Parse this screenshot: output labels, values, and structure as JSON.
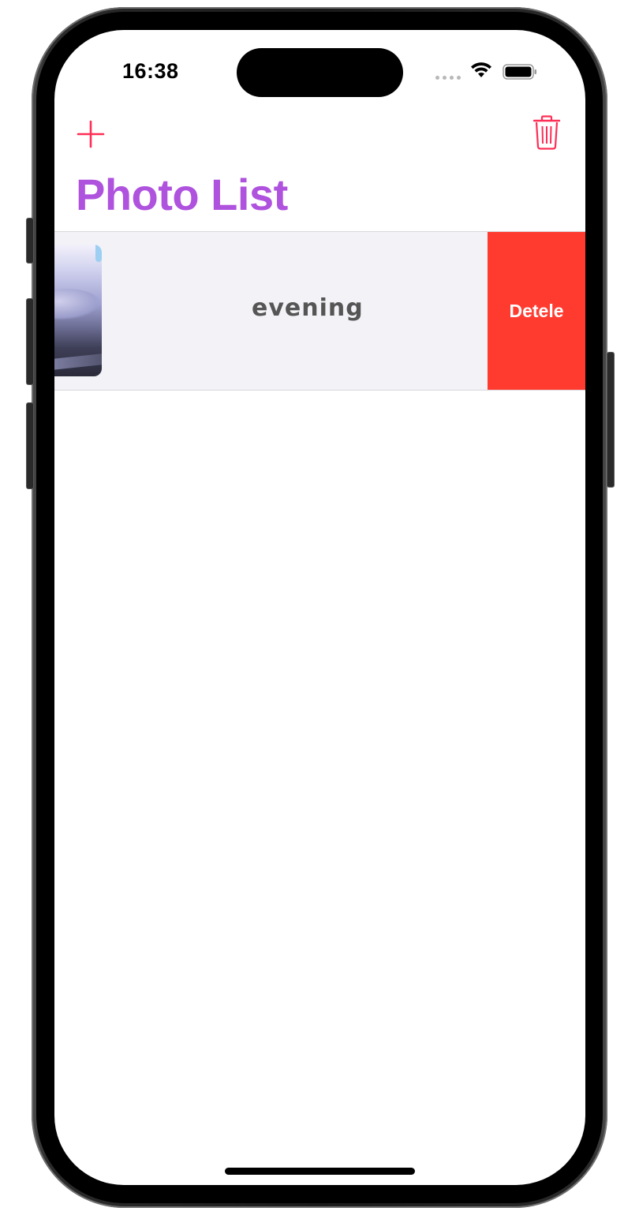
{
  "status_bar": {
    "time": "16:38",
    "wifi_icon": "wifi-icon",
    "battery_icon": "battery-icon",
    "signal_icon": "signal-dots-icon"
  },
  "nav": {
    "add_icon": "plus-icon",
    "trash_icon": "trash-icon",
    "title": "Photo List"
  },
  "list": {
    "rows": [
      {
        "label": "evening",
        "action_label": "Detele"
      }
    ]
  },
  "colors": {
    "accent": "#ff2d55",
    "title": "#af52de",
    "delete": "#ff3b30",
    "row_background": "#f2f2f7"
  }
}
